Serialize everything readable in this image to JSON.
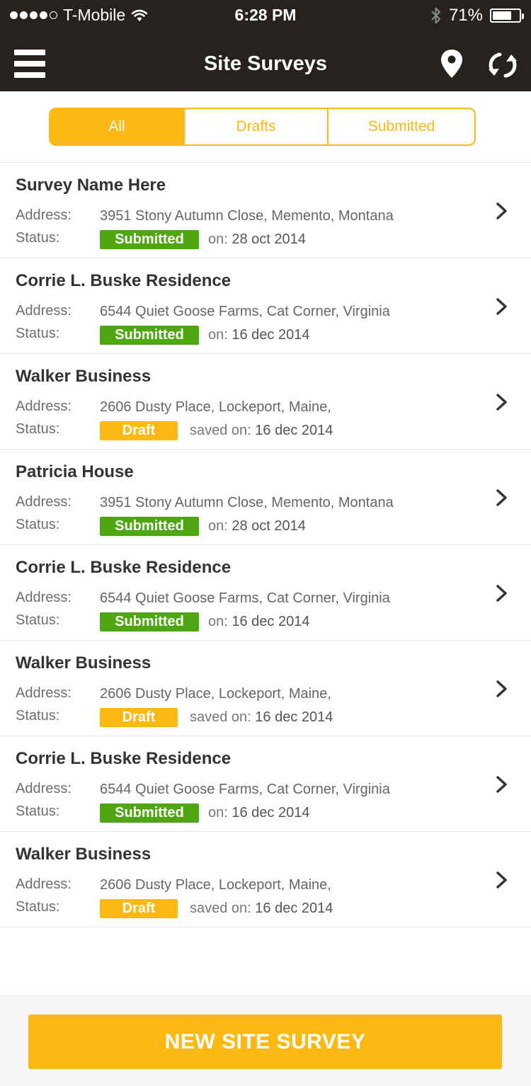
{
  "colors": {
    "accent": "#fcb813",
    "submitted": "#4ea611",
    "header": "#26221d"
  },
  "status_bar": {
    "carrier": "T-Mobile",
    "time": "6:28 PM",
    "battery": "71%"
  },
  "header": {
    "title": "Site Surveys",
    "icons": [
      "menu-icon",
      "location-pin-icon",
      "sync-icon"
    ]
  },
  "filter_tabs": [
    "All",
    "Drafts",
    "Submitted"
  ],
  "active_tab": "All",
  "labels": {
    "address": "Address:",
    "status": "Status:"
  },
  "surveys": [
    {
      "name": "Survey Name Here",
      "address": "3951 Stony Autumn Close, Memento, Montana",
      "status": "Submitted",
      "date_prefix": "on:",
      "date": "28 oct 2014"
    },
    {
      "name": "Corrie L. Buske Residence",
      "address": "6544 Quiet Goose Farms, Cat Corner, Virginia",
      "status": "Submitted",
      "date_prefix": "on:",
      "date": "16 dec 2014"
    },
    {
      "name": "Walker Business",
      "address": "2606 Dusty Place, Lockeport, Maine,",
      "status": "Draft",
      "date_prefix": "saved on:",
      "date": "16 dec 2014"
    },
    {
      "name": "Patricia House",
      "address": "3951 Stony Autumn Close, Memento, Montana",
      "status": "Submitted",
      "date_prefix": "on:",
      "date": "28 oct 2014"
    },
    {
      "name": "Corrie L. Buske Residence",
      "address": "6544 Quiet Goose Farms, Cat Corner, Virginia",
      "status": "Submitted",
      "date_prefix": "on:",
      "date": "16 dec 2014"
    },
    {
      "name": "Walker Business",
      "address": "2606 Dusty Place, Lockeport, Maine,",
      "status": "Draft",
      "date_prefix": "saved on:",
      "date": "16 dec 2014"
    },
    {
      "name": "Corrie L. Buske Residence",
      "address": "6544 Quiet Goose Farms, Cat Corner, Virginia",
      "status": "Submitted",
      "date_prefix": "on:",
      "date": "16 dec 2014"
    },
    {
      "name": "Walker Business",
      "address": "2606 Dusty Place, Lockeport, Maine,",
      "status": "Draft",
      "date_prefix": "saved on:",
      "date": "16 dec 2014"
    }
  ],
  "footer": {
    "new_button": "NEW SITE SURVEY"
  }
}
